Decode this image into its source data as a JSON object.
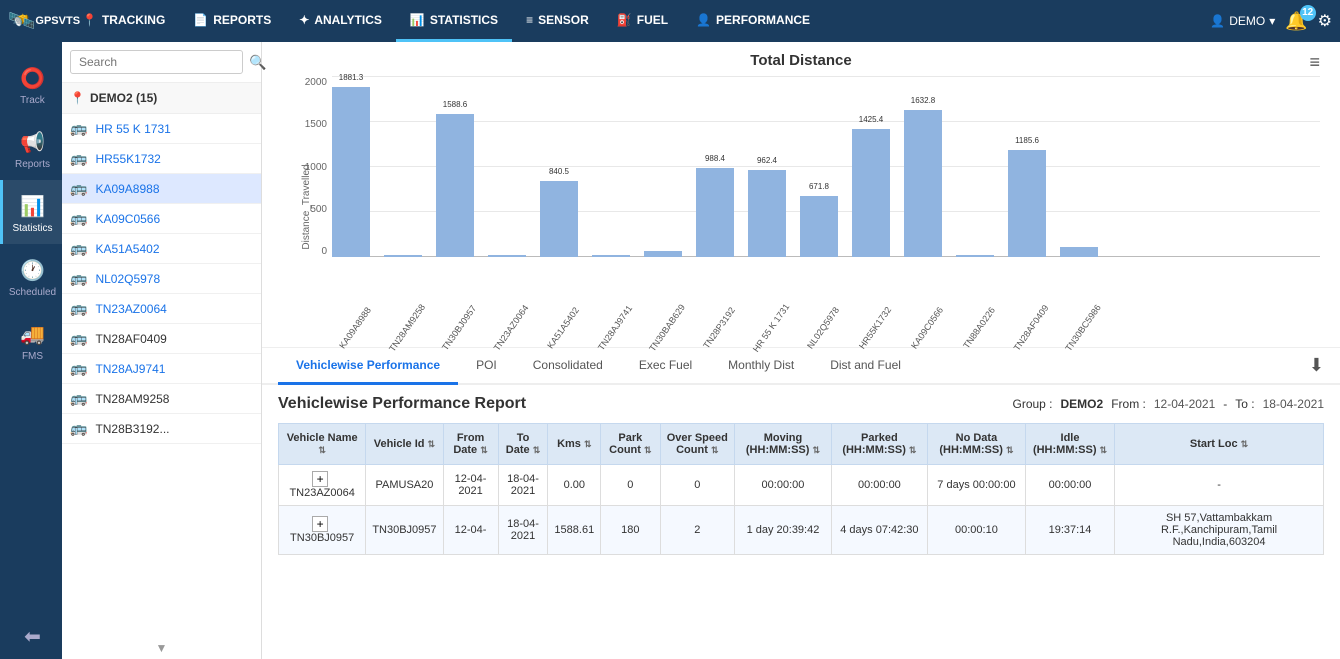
{
  "app": {
    "logo": "GPSVTS",
    "logo_icon": "📍"
  },
  "top_nav": {
    "items": [
      {
        "id": "tracking",
        "label": "TRACKING",
        "icon": "📍",
        "active": false
      },
      {
        "id": "reports",
        "label": "REPORTS",
        "icon": "📄",
        "active": false
      },
      {
        "id": "analytics",
        "label": "ANALYTICS",
        "icon": "✦",
        "active": false
      },
      {
        "id": "statistics",
        "label": "STATISTICS",
        "icon": "📊",
        "active": true
      },
      {
        "id": "sensor",
        "label": "SENSOR",
        "icon": "≡",
        "active": false
      },
      {
        "id": "fuel",
        "label": "FUEL",
        "icon": "⛽",
        "active": false
      },
      {
        "id": "performance",
        "label": "PERFORMANCE",
        "icon": "👤",
        "active": false
      }
    ],
    "user_label": "DEMO",
    "notification_count": "12"
  },
  "left_sidebar": {
    "items": [
      {
        "id": "track",
        "label": "Track",
        "icon": "⭕"
      },
      {
        "id": "reports",
        "label": "Reports",
        "icon": "📢"
      },
      {
        "id": "statistics",
        "label": "Statistics",
        "icon": "📊",
        "active": true
      },
      {
        "id": "scheduled",
        "label": "Scheduled",
        "icon": "🕐"
      },
      {
        "id": "fms",
        "label": "FMS",
        "icon": "🚚"
      },
      {
        "id": "logout",
        "label": "",
        "icon": "⬅"
      }
    ]
  },
  "vehicle_panel": {
    "search_placeholder": "Search",
    "group_label": "DEMO2 (15)",
    "group_icon": "📍",
    "vehicles": [
      {
        "id": "HR55K1731",
        "name": "HR 55 K 1731",
        "status": "normal",
        "active": false
      },
      {
        "id": "HR55K1732",
        "name": "HR55K1732",
        "status": "normal",
        "active": false
      },
      {
        "id": "KA09A8988",
        "name": "KA09A8988",
        "status": "normal",
        "active": true
      },
      {
        "id": "KA09C0566",
        "name": "KA09C0566",
        "status": "normal",
        "active": false
      },
      {
        "id": "KA51A5402",
        "name": "KA51A5402",
        "status": "red",
        "active": false
      },
      {
        "id": "NL02Q5978",
        "name": "NL02Q5978",
        "status": "normal",
        "active": false
      },
      {
        "id": "TN23AZ0064",
        "name": "TN23AZ0064",
        "status": "red",
        "active": false
      },
      {
        "id": "TN28AF0409",
        "name": "TN28AF0409",
        "status": "normal",
        "active": false
      },
      {
        "id": "TN28AJ9741",
        "name": "TN28AJ9741",
        "status": "red",
        "active": false
      },
      {
        "id": "TN28AM9258",
        "name": "TN28AM9258",
        "status": "normal",
        "active": false
      },
      {
        "id": "TN28B3192",
        "name": "TN28B3192...",
        "status": "green",
        "active": false
      }
    ]
  },
  "chart": {
    "title": "Total Distance",
    "y_axis_label": "Distance_Travelled",
    "y_ticks": [
      "2000",
      "1500",
      "1000",
      "500",
      "0"
    ],
    "bars": [
      {
        "label": "KA09A8988",
        "value": 1881.3,
        "height_pct": 94
      },
      {
        "label": "TN28AM9258",
        "value": null,
        "height_pct": 0
      },
      {
        "label": "TN30BJ0957",
        "value": 1588.6,
        "height_pct": 79
      },
      {
        "label": "TN23AZ0064",
        "value": null,
        "height_pct": 0
      },
      {
        "label": "KA51A5402",
        "value": 840.5,
        "height_pct": 42
      },
      {
        "label": "TN28AJ9741",
        "value": null,
        "height_pct": 0
      },
      {
        "label": "TN30BAB629",
        "value": null,
        "height_pct": 2
      },
      {
        "label": "TN28P3192",
        "value": 988.4,
        "height_pct": 49
      },
      {
        "label": "HR 55 K 1731",
        "value": 962.4,
        "height_pct": 48
      },
      {
        "label": "NL02Q5978",
        "value": 671.8,
        "height_pct": 34
      },
      {
        "label": "HR55K1732",
        "value": 1425.4,
        "height_pct": 71
      },
      {
        "label": "KA09C0566",
        "value": 1632.8,
        "height_pct": 82
      },
      {
        "label": "TN88A0226",
        "value": null,
        "height_pct": 0
      },
      {
        "label": "TN28AF0409",
        "value": 1185.6,
        "height_pct": 59
      },
      {
        "label": "TN30BC5986",
        "value": null,
        "height_pct": 5
      }
    ]
  },
  "tabs": {
    "items": [
      {
        "id": "vehiclewise",
        "label": "Vehiclewise Performance",
        "active": true
      },
      {
        "id": "poi",
        "label": "POI",
        "active": false
      },
      {
        "id": "consolidated",
        "label": "Consolidated",
        "active": false
      },
      {
        "id": "execfuel",
        "label": "Exec Fuel",
        "active": false
      },
      {
        "id": "monthlydist",
        "label": "Monthly Dist",
        "active": false
      },
      {
        "id": "distandfuel",
        "label": "Dist and Fuel",
        "active": false
      }
    ]
  },
  "report": {
    "title": "Vehiclewise Performance Report",
    "group_prefix": "Group :",
    "group_name": "DEMO2",
    "from_prefix": "From :",
    "from_date": "12-04-2021",
    "dash": "-",
    "to_prefix": "To :",
    "to_date": "18-04-2021",
    "columns": [
      "Vehicle Name",
      "Vehicle Id",
      "From Date",
      "To Date",
      "Kms",
      "Park Count",
      "Over Speed Count",
      "Moving (HH:MM:SS)",
      "Parked (HH:MM:SS)",
      "No Data (HH:MM:SS)",
      "Idle (HH:MM:SS)",
      "Start Loc"
    ],
    "rows": [
      {
        "expand": "+",
        "vehicle_name": "TN23AZ0064",
        "vehicle_id": "PAMUSA20",
        "from_date": "12-04-2021",
        "to_date": "18-04-2021",
        "kms": "0.00",
        "park_count": "0",
        "over_speed": "0",
        "moving": "00:00:00",
        "parked": "00:00:00",
        "no_data": "7 days 00:00:00",
        "idle": "00:00:00",
        "start_loc": "-"
      },
      {
        "expand": "+",
        "vehicle_name": "TN30BJ0957",
        "vehicle_id": "TN30BJ0957",
        "from_date": "12-04-",
        "to_date": "18-04-2021",
        "kms": "1588.61",
        "park_count": "180",
        "over_speed": "2",
        "moving": "1 day 20:39:42",
        "parked": "4 days 07:42:30",
        "no_data": "00:00:10",
        "idle": "19:37:14",
        "start_loc": "SH 57,Vattambakkam R.F.,Kanchipuram,Tamil Nadu,India,603204",
        "start_loc_short": "SH R.F.,Kanchipur"
      }
    ]
  }
}
